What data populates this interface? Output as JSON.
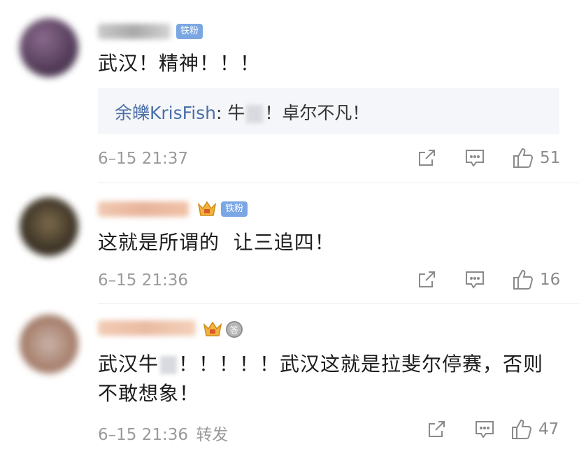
{
  "comments": [
    {
      "text": "武汉！精神！！！",
      "badge": "铁粉",
      "reply": {
        "name": "余皪KrisFish",
        "sep": ": ",
        "before": "牛",
        "after": "！卓尔不凡！"
      },
      "timestamp": "6–15 21:37",
      "likes": "51"
    },
    {
      "text": "这就是所谓的  让三追四！",
      "badge": "铁粉",
      "timestamp": "6–15 21:36",
      "likes": "16"
    },
    {
      "text_before": "武汉牛",
      "text_after": "！！！！！武汉这就是拉斐尔停赛，否则",
      "text_line2": "不敢想象！",
      "medal": "答",
      "timestamp": "6–15 21:36",
      "forward_label": "转发",
      "likes": "47"
    }
  ],
  "icons": [
    "share-icon",
    "comment-icon",
    "like-icon",
    "crown-icon",
    "medal-icon"
  ],
  "colors": {
    "badge": "#7aa7e3",
    "reply_name": "#4a6fa8",
    "meta": "#9a9a9a",
    "reply_bg": "#f5f6f9"
  }
}
